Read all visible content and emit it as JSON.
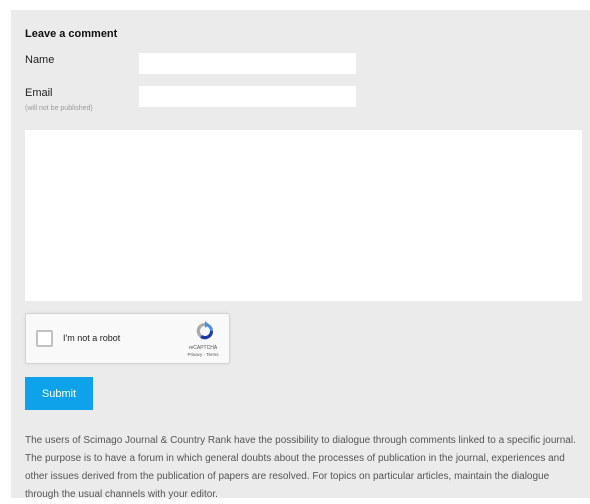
{
  "comment_form": {
    "heading": "Leave a comment",
    "name_label": "Name",
    "email_label": "Email",
    "email_note": "(will not be published)",
    "name_value": "",
    "email_value": "",
    "comment_value": "",
    "submit_label": "Submit"
  },
  "recaptcha": {
    "checkbox_label": "I'm not a robot",
    "brand": "reCAPTCHA",
    "links": "Privacy - Terms",
    "checked": false,
    "colors": {
      "blue": "#1c3aa9",
      "light_blue": "#4a90e2",
      "grey": "#aaaaaa"
    }
  },
  "info_text": "The users of Scimago Journal & Country Rank have the possibility to dialogue through comments linked to a specific journal. The purpose is to have a forum in which general doubts about the processes of publication in the journal, experiences and other issues derived from the publication of papers are resolved. For topics on particular articles, maintain the dialogue through the usual channels with your editor.",
  "colors": {
    "panel_bg": "#ebebeb",
    "submit_bg": "#0da2ea",
    "field_bg": "#ffffff"
  }
}
